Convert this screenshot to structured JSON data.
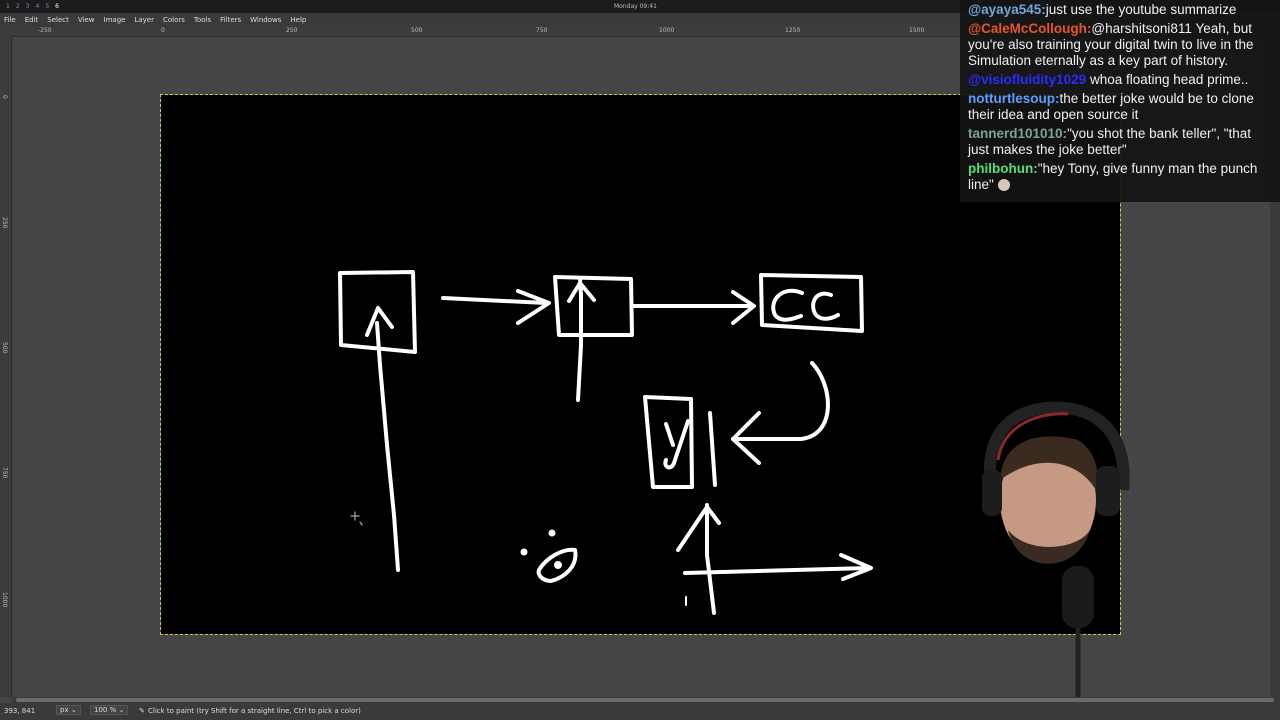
{
  "system_bar": {
    "workspaces": [
      "1",
      "2",
      "3",
      "4",
      "5",
      "6"
    ],
    "clock": "Monday 09:41"
  },
  "menubar": {
    "items": [
      "File",
      "Edit",
      "Select",
      "View",
      "Image",
      "Layer",
      "Colors",
      "Tools",
      "Filters",
      "Windows",
      "Help"
    ]
  },
  "ruler": {
    "h_ticks": [
      "-250",
      "0",
      "250",
      "500",
      "750",
      "1000",
      "1250",
      "1500"
    ],
    "v_ticks": [
      "0",
      "250",
      "500",
      "750",
      "1000"
    ]
  },
  "canvas": {
    "background": "#000000",
    "stroke_color": "#ffffff",
    "boxes": [
      {
        "label": "",
        "name": "box-1"
      },
      {
        "label": "",
        "name": "box-2"
      },
      {
        "label": "CC",
        "name": "box-cc"
      },
      {
        "label": "y",
        "name": "box-y"
      }
    ]
  },
  "chat": {
    "messages": [
      {
        "user": "@ayaya545:",
        "color": "#6fa8dc",
        "text": "just use the youtube summarize"
      },
      {
        "user": "@CaleMcCollough:",
        "color": "#e8552a",
        "text": "@harshitsoni811 Yeah, but you're also training your digital twin to live in the Simulation eternally as a key part of history."
      },
      {
        "user": "@visiofluidity1029",
        "color": "#2b2bff",
        "text": "whoa floating head prime.."
      },
      {
        "user": "notturtlesoup:",
        "color": "#5aa0ff",
        "text": "the better joke would be to clone their idea and open source it"
      },
      {
        "user": "tannerd101010:",
        "color": "#7aa59a",
        "text": "\"you shot the bank teller\", \"that just makes the joke better\""
      },
      {
        "user": "philbohun:",
        "color": "#52e07a",
        "text": "\"hey Tony, give funny man the punch line\""
      }
    ]
  },
  "statusbar": {
    "coords": "393, 841",
    "unit": "px",
    "zoom": "100 %",
    "hint": "Click to paint (try Shift for a straight line, Ctrl to pick a color)"
  }
}
